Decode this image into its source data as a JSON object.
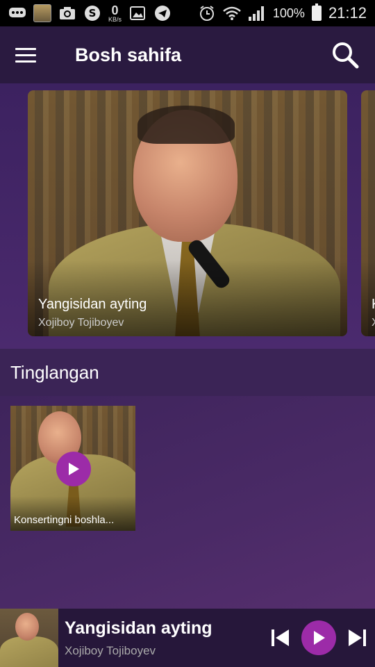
{
  "status_bar": {
    "kbs_value": "0",
    "kbs_unit": "KB/s",
    "battery": "100%",
    "time": "21:12"
  },
  "app_bar": {
    "title": "Bosh sahifa"
  },
  "carousel": {
    "items": [
      {
        "title": "Yangisidan ayting",
        "artist": "Xojiboy Tojiboyev"
      },
      {
        "title": "K",
        "artist": "X"
      }
    ]
  },
  "section": {
    "title": "Tinglangan"
  },
  "recent": {
    "items": [
      {
        "title": "Konsertingni boshla..."
      }
    ]
  },
  "mini_player": {
    "title": "Yangisidan ayting",
    "artist": "Xojiboy Tojiboyev"
  },
  "colors": {
    "accent": "#9c2ba8",
    "background_dark": "#2a1a40"
  }
}
